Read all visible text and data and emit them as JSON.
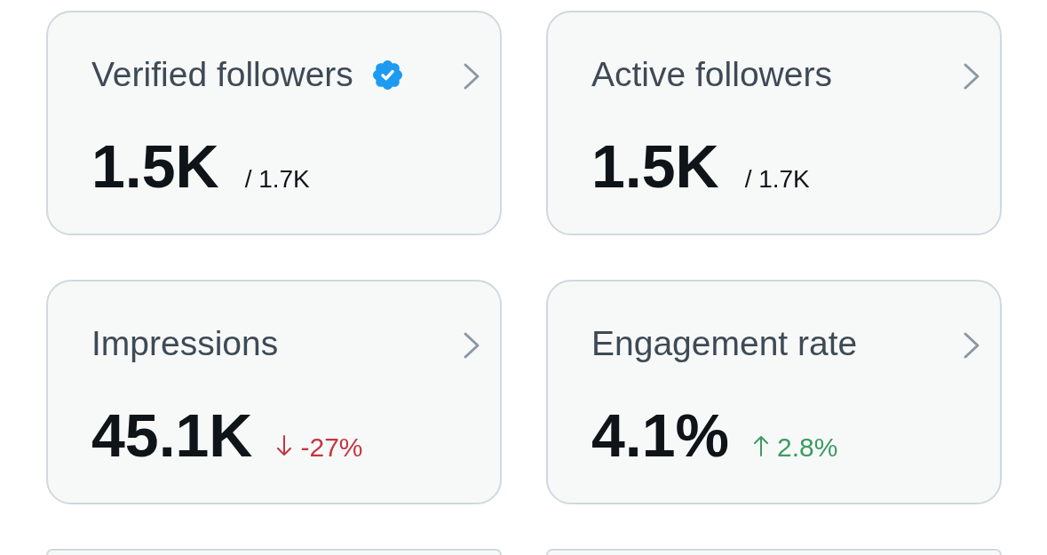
{
  "cards": [
    {
      "kind": "metric",
      "title": "Verified followers",
      "verified": true,
      "value": "1.5K",
      "total": "/ 1.7K"
    },
    {
      "kind": "metric",
      "title": "Active followers",
      "verified": false,
      "value": "1.5K",
      "total": "/ 1.7K"
    },
    {
      "kind": "metric",
      "title": "Impressions",
      "verified": false,
      "value": "45.1K",
      "trend": {
        "kind": "down",
        "text": "-27%"
      }
    },
    {
      "kind": "metric",
      "title": "Engagement rate",
      "verified": false,
      "value": "4.1%",
      "trend": {
        "kind": "up",
        "text": "2.8%"
      }
    },
    {
      "kind": "cut_off"
    },
    {
      "kind": "cut_off"
    }
  ]
}
